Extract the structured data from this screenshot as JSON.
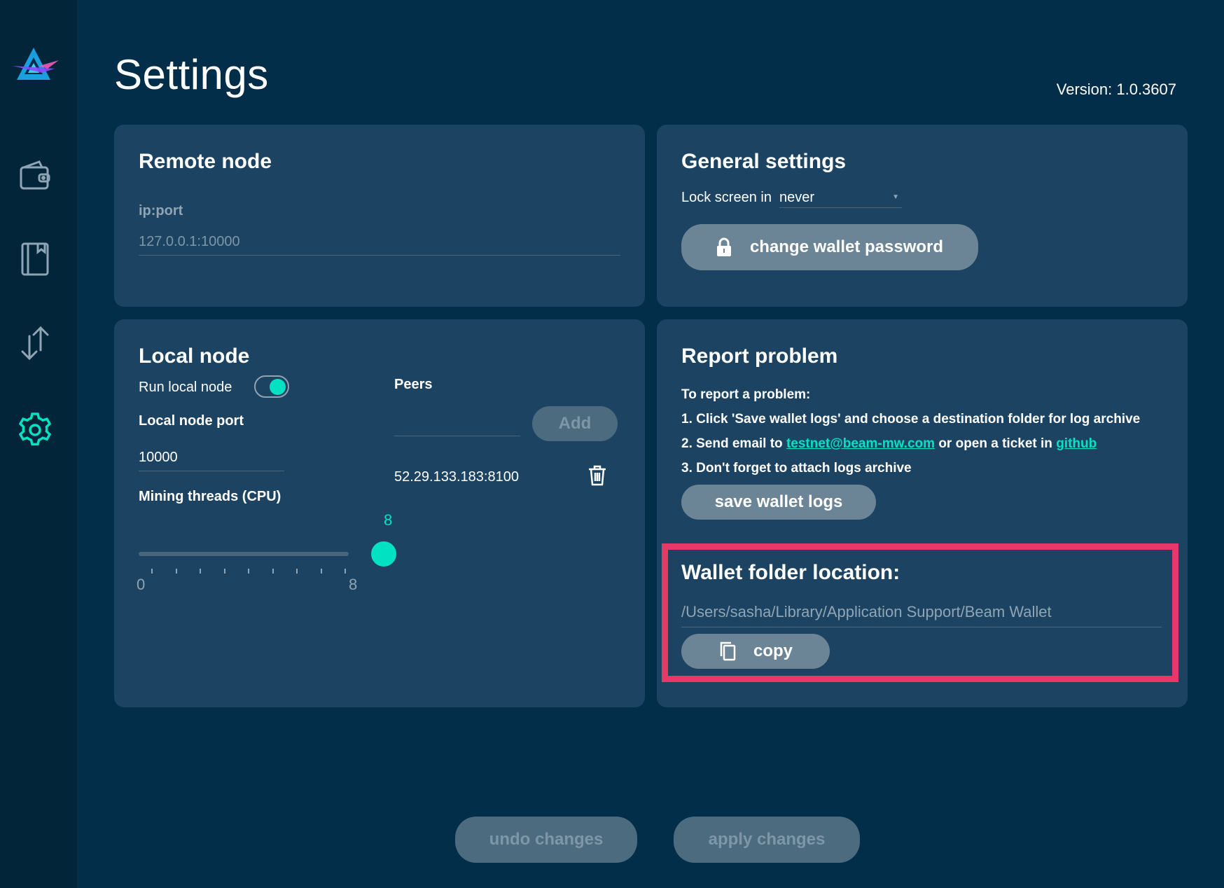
{
  "page": {
    "title": "Settings",
    "version": "Version: 1.0.3607"
  },
  "sidebar": {
    "items": [
      {
        "name": "wallet",
        "icon": "wallet-icon"
      },
      {
        "name": "addresses",
        "icon": "address-book-icon"
      },
      {
        "name": "transactions",
        "icon": "transfer-arrows-icon"
      },
      {
        "name": "settings",
        "icon": "gear-icon",
        "active": true
      }
    ]
  },
  "remote_node": {
    "title": "Remote node",
    "field_label": "ip:port",
    "field_placeholder": "127.0.0.1:10000"
  },
  "general": {
    "title": "General settings",
    "lock_label": "Lock screen in",
    "lock_value": "never",
    "change_password_label": "change wallet password"
  },
  "local_node": {
    "title": "Local node",
    "run_label": "Run local node",
    "run_enabled": true,
    "port_label": "Local node port",
    "port_value": "10000",
    "mining_label": "Mining threads (CPU)",
    "mining_value": "8",
    "mining_min": "0",
    "mining_max": "8",
    "peers_label": "Peers",
    "add_label": "Add",
    "peers": [
      "52.29.133.183:8100"
    ]
  },
  "report": {
    "title": "Report problem",
    "intro": "To report a problem:",
    "step1": "1. Click 'Save wallet logs' and choose a destination folder for log archive",
    "step2_prefix": "2. Send email to",
    "step2_email": "testnet@beam-mw.com",
    "step2_middle": "or open a ticket in",
    "step2_link": "github",
    "step3": "3. Don't forget to attach logs archive",
    "save_logs_label": "save wallet logs"
  },
  "wallet_folder": {
    "title": "Wallet folder location:",
    "path": "/Users/sasha/Library/Application Support/Beam Wallet",
    "copy_label": "copy"
  },
  "footer": {
    "undo_label": "undo changes",
    "apply_label": "apply changes"
  },
  "colors": {
    "background": "#032e49",
    "sidebar": "#02253a",
    "panel": "#1c4462",
    "accent": "#00e2c2",
    "highlight": "#e8386a"
  }
}
